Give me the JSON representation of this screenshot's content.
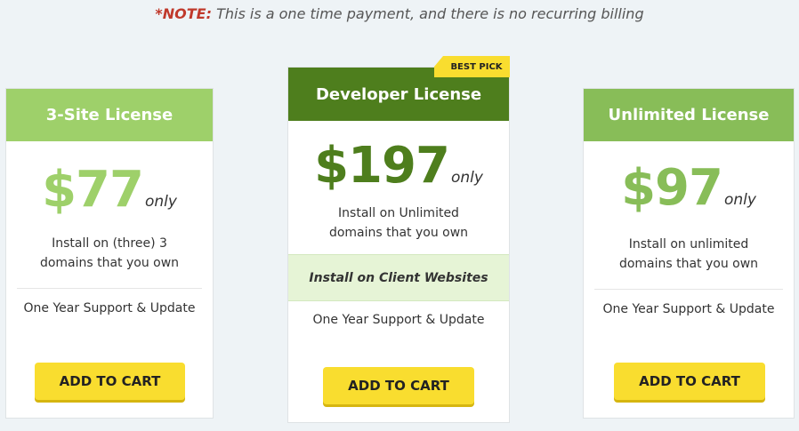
{
  "note": {
    "label": "*NOTE:",
    "text": " This is a one time payment, and there is no recurring billing"
  },
  "colors": {
    "light_green": "#9ed06a",
    "dark_green": "#4e7e1d",
    "mid_green": "#88bd58",
    "button_yellow": "#f9dd2f"
  },
  "plans": [
    {
      "title": "3-Site License",
      "price": "$77",
      "only": "only",
      "desc_line1": "Install on (three) 3",
      "desc_line2": "domains that you own",
      "support": "One Year Support & Update",
      "button": "ADD TO CART"
    },
    {
      "title": "Developer License",
      "badge": "BEST PICK",
      "price": "$197",
      "only": "only",
      "desc_line1": "Install on Unlimited",
      "desc_line2": "domains that you own",
      "extra": "Install on Client Websites",
      "support": "One Year Support & Update",
      "button": "ADD TO CART"
    },
    {
      "title": "Unlimited License",
      "price": "$97",
      "only": "only",
      "desc_line1": "Install on unlimited",
      "desc_line2": "domains  that you own",
      "support": "One Year Support & Update",
      "button": "ADD TO CART"
    }
  ]
}
